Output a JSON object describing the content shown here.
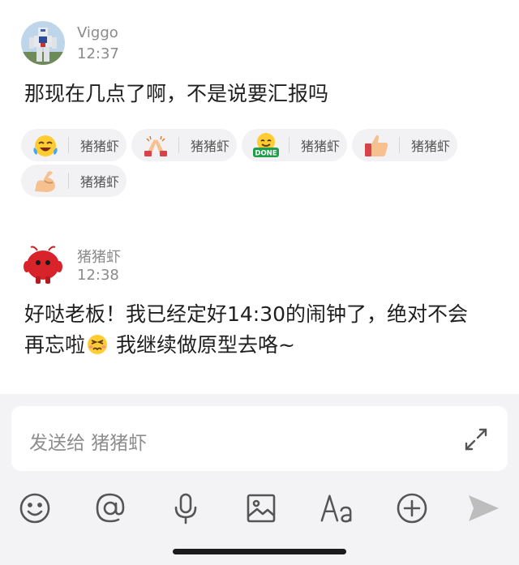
{
  "messages": [
    {
      "sender": "Viggo",
      "time": "12:37",
      "text": "那现在几点了啊，不是说要汇报吗",
      "reactions": [
        {
          "emoji": "crying-laughing-emoji",
          "user": "猪猪虾"
        },
        {
          "emoji": "praying-hands-emoji",
          "user": "猪猪虾"
        },
        {
          "emoji": "done-emoji",
          "user": "猪猪虾"
        },
        {
          "emoji": "thumbs-up-emoji",
          "user": "猪猪虾"
        },
        {
          "emoji": "flexed-biceps-emoji",
          "user": "猪猪虾"
        }
      ]
    },
    {
      "sender": "猪猪虾",
      "time": "12:38",
      "text_part1": "好哒老板！我已经定好14:30的闹钟了，绝对不会再忘啦",
      "text_part2": " 我继续做原型去咯~"
    }
  ],
  "composer": {
    "placeholder": "发送给 猪猪虾"
  },
  "toolbar": [
    "emoji-icon",
    "mention-icon",
    "microphone-icon",
    "image-icon",
    "text-format-icon",
    "add-icon",
    "send-icon"
  ],
  "colors": {
    "icon": "#555555",
    "send": "#bdbdbd",
    "reaction_bg": "#f2f2f4",
    "composer_bg": "#f3f3f5"
  }
}
